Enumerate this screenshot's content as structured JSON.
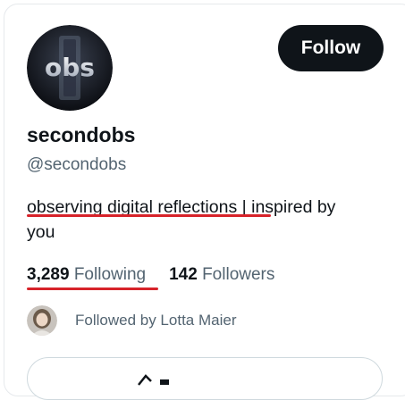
{
  "profile": {
    "display_name": "secondobs",
    "handle": "@secondobs",
    "avatar_text": "obs",
    "bio_highlight": "observing digital reflections",
    "bio_rest_line1": " | inspired by",
    "bio_rest_line2": "you"
  },
  "actions": {
    "follow_label": "Follow"
  },
  "stats": {
    "following_count": "3,289",
    "following_label": "Following",
    "followers_count": "142",
    "followers_label": "Followers"
  },
  "social_context": {
    "text": "Followed by Lotta Maier"
  },
  "colors": {
    "accent_red": "#d7232a",
    "button_dark": "#0f1419",
    "secondary_text": "#536471"
  }
}
